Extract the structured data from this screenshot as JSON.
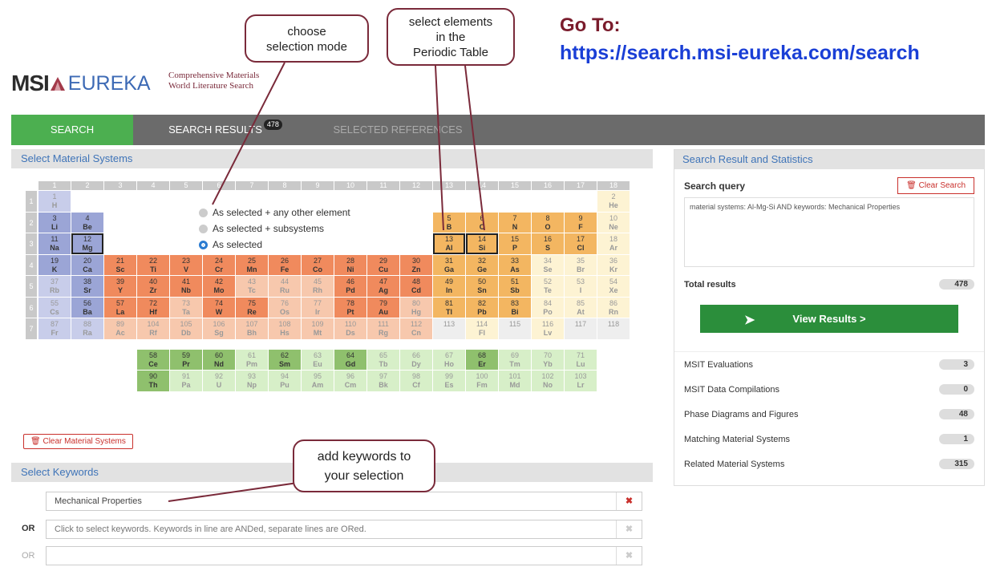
{
  "goto": {
    "title": "Go To:",
    "url": "https://search.msi-eureka.com/search"
  },
  "callouts": {
    "mode": "choose\nselection mode",
    "select": "select elements\nin the\nPeriodic Table",
    "keywords": "add keywords to\nyour selection"
  },
  "logo": {
    "msi": "MSI",
    "eureka": "EUREKA",
    "tagline1": "Comprehensive Materials",
    "tagline2": "World Literature Search"
  },
  "tabs": {
    "search": "SEARCH",
    "results": "SEARCH RESULTS",
    "results_count": "478",
    "selected": "SELECTED REFERENCES"
  },
  "left": {
    "title": "Select Material Systems",
    "clear": "Clear Material Systems"
  },
  "radios": [
    "As selected + any other element",
    "As selected + subsystems",
    "As selected"
  ],
  "keywords": {
    "title": "Select Keywords",
    "row1": "Mechanical Properties",
    "or1": "OR",
    "row2_placeholder": "Click to select keywords. Keywords in line are ANDed, separate lines are ORed.",
    "or2": "OR"
  },
  "right": {
    "title": "Search Result and Statistics",
    "query_label": "Search query",
    "clear": "Clear Search",
    "query": "material systems: Al-Mg-Si AND keywords: Mechanical Properties",
    "total_label": "Total results",
    "total": "478",
    "view": "View Results >"
  },
  "stats": [
    {
      "label": "MSIT Evaluations",
      "value": "3"
    },
    {
      "label": "MSIT Data Compilations",
      "value": "0"
    },
    {
      "label": "Phase Diagrams and Figures",
      "value": "48"
    },
    {
      "label": "Matching Material Systems",
      "value": "1"
    },
    {
      "label": "Related Material Systems",
      "value": "315"
    }
  ],
  "periodic": {
    "groups": [
      "1",
      "2",
      "3",
      "4",
      "5",
      "6",
      "7",
      "8",
      "9",
      "10",
      "11",
      "12",
      "13",
      "14",
      "15",
      "16",
      "17",
      "18"
    ],
    "periods": [
      "1",
      "2",
      "3",
      "4",
      "5",
      "6",
      "7"
    ],
    "elements": [
      [
        "1",
        "H",
        1,
        1,
        "b",
        0
      ],
      [
        "2",
        "He",
        18,
        1,
        "y",
        0
      ],
      [
        "3",
        "Li",
        1,
        2,
        "b",
        1
      ],
      [
        "4",
        "Be",
        2,
        2,
        "b",
        1
      ],
      [
        "5",
        "B",
        13,
        2,
        "o",
        1
      ],
      [
        "6",
        "C",
        14,
        2,
        "o",
        1
      ],
      [
        "7",
        "N",
        15,
        2,
        "o",
        1
      ],
      [
        "8",
        "O",
        16,
        2,
        "o",
        1
      ],
      [
        "9",
        "F",
        17,
        2,
        "o",
        1
      ],
      [
        "10",
        "Ne",
        18,
        2,
        "y",
        0
      ],
      [
        "11",
        "Na",
        1,
        3,
        "b",
        1
      ],
      [
        "12",
        "Mg",
        2,
        3,
        "b",
        1
      ],
      [
        "13",
        "Al",
        13,
        3,
        "o",
        1
      ],
      [
        "14",
        "Si",
        14,
        3,
        "o",
        1
      ],
      [
        "15",
        "P",
        15,
        3,
        "o",
        1
      ],
      [
        "16",
        "S",
        16,
        3,
        "o",
        1
      ],
      [
        "17",
        "Cl",
        17,
        3,
        "o",
        1
      ],
      [
        "18",
        "Ar",
        18,
        3,
        "y",
        0
      ],
      [
        "19",
        "K",
        1,
        4,
        "b",
        1
      ],
      [
        "20",
        "Ca",
        2,
        4,
        "b",
        1
      ],
      [
        "21",
        "Sc",
        3,
        4,
        "r",
        1
      ],
      [
        "22",
        "Ti",
        4,
        4,
        "r",
        1
      ],
      [
        "23",
        "V",
        5,
        4,
        "r",
        1
      ],
      [
        "24",
        "Cr",
        6,
        4,
        "r",
        1
      ],
      [
        "25",
        "Mn",
        7,
        4,
        "r",
        1
      ],
      [
        "26",
        "Fe",
        8,
        4,
        "r",
        1
      ],
      [
        "27",
        "Co",
        9,
        4,
        "r",
        1
      ],
      [
        "28",
        "Ni",
        10,
        4,
        "r",
        1
      ],
      [
        "29",
        "Cu",
        11,
        4,
        "r",
        1
      ],
      [
        "30",
        "Zn",
        12,
        4,
        "r",
        1
      ],
      [
        "31",
        "Ga",
        13,
        4,
        "o",
        1
      ],
      [
        "32",
        "Ge",
        14,
        4,
        "o",
        1
      ],
      [
        "33",
        "As",
        15,
        4,
        "o",
        1
      ],
      [
        "34",
        "Se",
        16,
        4,
        "y",
        0
      ],
      [
        "35",
        "Br",
        17,
        4,
        "y",
        0
      ],
      [
        "36",
        "Kr",
        18,
        4,
        "y",
        0
      ],
      [
        "37",
        "Rb",
        1,
        5,
        "b",
        0
      ],
      [
        "38",
        "Sr",
        2,
        5,
        "b",
        1
      ],
      [
        "39",
        "Y",
        3,
        5,
        "r",
        1
      ],
      [
        "40",
        "Zr",
        4,
        5,
        "r",
        1
      ],
      [
        "41",
        "Nb",
        5,
        5,
        "r",
        1
      ],
      [
        "42",
        "Mo",
        6,
        5,
        "r",
        1
      ],
      [
        "43",
        "Tc",
        7,
        5,
        "r",
        0
      ],
      [
        "44",
        "Ru",
        8,
        5,
        "r",
        0
      ],
      [
        "45",
        "Rh",
        9,
        5,
        "r",
        0
      ],
      [
        "46",
        "Pd",
        10,
        5,
        "r",
        1
      ],
      [
        "47",
        "Ag",
        11,
        5,
        "r",
        1
      ],
      [
        "48",
        "Cd",
        12,
        5,
        "r",
        1
      ],
      [
        "49",
        "In",
        13,
        5,
        "o",
        1
      ],
      [
        "50",
        "Sn",
        14,
        5,
        "o",
        1
      ],
      [
        "51",
        "Sb",
        15,
        5,
        "o",
        1
      ],
      [
        "52",
        "Te",
        16,
        5,
        "y",
        0
      ],
      [
        "53",
        "I",
        17,
        5,
        "y",
        0
      ],
      [
        "54",
        "Xe",
        18,
        5,
        "y",
        0
      ],
      [
        "55",
        "Cs",
        1,
        6,
        "b",
        0
      ],
      [
        "56",
        "Ba",
        2,
        6,
        "b",
        1
      ],
      [
        "57",
        "La",
        3,
        6,
        "r",
        1
      ],
      [
        "72",
        "Hf",
        4,
        6,
        "r",
        1
      ],
      [
        "73",
        "Ta",
        5,
        6,
        "r",
        0
      ],
      [
        "74",
        "W",
        6,
        6,
        "r",
        1
      ],
      [
        "75",
        "Re",
        7,
        6,
        "r",
        1
      ],
      [
        "76",
        "Os",
        8,
        6,
        "r",
        0
      ],
      [
        "77",
        "Ir",
        9,
        6,
        "r",
        0
      ],
      [
        "78",
        "Pt",
        10,
        6,
        "r",
        1
      ],
      [
        "79",
        "Au",
        11,
        6,
        "r",
        1
      ],
      [
        "80",
        "Hg",
        12,
        6,
        "r",
        0
      ],
      [
        "81",
        "Tl",
        13,
        6,
        "o",
        1
      ],
      [
        "82",
        "Pb",
        14,
        6,
        "o",
        1
      ],
      [
        "83",
        "Bi",
        15,
        6,
        "o",
        1
      ],
      [
        "84",
        "Po",
        16,
        6,
        "y",
        0
      ],
      [
        "85",
        "At",
        17,
        6,
        "y",
        0
      ],
      [
        "86",
        "Rn",
        18,
        6,
        "y",
        0
      ],
      [
        "87",
        "Fr",
        1,
        7,
        "b",
        0
      ],
      [
        "88",
        "Ra",
        2,
        7,
        "b",
        0
      ],
      [
        "89",
        "Ac",
        3,
        7,
        "r",
        0
      ],
      [
        "104",
        "Rf",
        4,
        7,
        "r",
        0
      ],
      [
        "105",
        "Db",
        5,
        7,
        "r",
        0
      ],
      [
        "106",
        "Sg",
        6,
        7,
        "r",
        0
      ],
      [
        "107",
        "Bh",
        7,
        7,
        "r",
        0
      ],
      [
        "108",
        "Hs",
        8,
        7,
        "r",
        0
      ],
      [
        "109",
        "Mt",
        9,
        7,
        "r",
        0
      ],
      [
        "110",
        "Ds",
        10,
        7,
        "r",
        0
      ],
      [
        "111",
        "Rg",
        11,
        7,
        "r",
        0
      ],
      [
        "112",
        "Cn",
        12,
        7,
        "r",
        0
      ],
      [
        "113",
        "",
        13,
        7,
        "w",
        0
      ],
      [
        "114",
        "Fl",
        14,
        7,
        "y",
        0
      ],
      [
        "115",
        "",
        15,
        7,
        "w",
        0
      ],
      [
        "116",
        "Lv",
        16,
        7,
        "y",
        0
      ],
      [
        "117",
        "",
        17,
        7,
        "w",
        0
      ],
      [
        "118",
        "",
        18,
        7,
        "w",
        0
      ],
      [
        "58",
        "Ce",
        4,
        9,
        "g",
        1
      ],
      [
        "59",
        "Pr",
        5,
        9,
        "g",
        1
      ],
      [
        "60",
        "Nd",
        6,
        9,
        "g",
        1
      ],
      [
        "61",
        "Pm",
        7,
        9,
        "g",
        0
      ],
      [
        "62",
        "Sm",
        8,
        9,
        "g",
        1
      ],
      [
        "63",
        "Eu",
        9,
        9,
        "g",
        0
      ],
      [
        "64",
        "Gd",
        10,
        9,
        "g",
        1
      ],
      [
        "65",
        "Tb",
        11,
        9,
        "g",
        0
      ],
      [
        "66",
        "Dy",
        12,
        9,
        "g",
        0
      ],
      [
        "67",
        "Ho",
        13,
        9,
        "g",
        0
      ],
      [
        "68",
        "Er",
        14,
        9,
        "g",
        1
      ],
      [
        "69",
        "Tm",
        15,
        9,
        "g",
        0
      ],
      [
        "70",
        "Yb",
        16,
        9,
        "g",
        0
      ],
      [
        "71",
        "Lu",
        17,
        9,
        "g",
        0
      ],
      [
        "90",
        "Th",
        4,
        10,
        "g",
        1
      ],
      [
        "91",
        "Pa",
        5,
        10,
        "g",
        0
      ],
      [
        "92",
        "U",
        6,
        10,
        "g",
        0
      ],
      [
        "93",
        "Np",
        7,
        10,
        "g",
        0
      ],
      [
        "94",
        "Pu",
        8,
        10,
        "g",
        0
      ],
      [
        "95",
        "Am",
        9,
        10,
        "g",
        0
      ],
      [
        "96",
        "Cm",
        10,
        10,
        "g",
        0
      ],
      [
        "97",
        "Bk",
        11,
        10,
        "g",
        0
      ],
      [
        "98",
        "Cf",
        12,
        10,
        "g",
        0
      ],
      [
        "99",
        "Es",
        13,
        10,
        "g",
        0
      ],
      [
        "100",
        "Fm",
        14,
        10,
        "g",
        0
      ],
      [
        "101",
        "Md",
        15,
        10,
        "g",
        0
      ],
      [
        "102",
        "No",
        16,
        10,
        "g",
        0
      ],
      [
        "103",
        "Lr",
        17,
        10,
        "g",
        0
      ]
    ],
    "selected": [
      "Mg",
      "Al",
      "Si"
    ]
  },
  "colors": {
    "b": [
      "#9ba5d6",
      "#c8cdea"
    ],
    "r": [
      "#f08a5d",
      "#f7c8ad"
    ],
    "o": [
      "#f3b661",
      "#f9dcae"
    ],
    "y": [
      "#fbe6a2",
      "#fdf3d3"
    ],
    "g": [
      "#8fc06d",
      "#d7efc8"
    ],
    "w": [
      "#eeeeee",
      "#eeeeee"
    ],
    "accent": "#4caf50",
    "brand": "#7a2a3a"
  }
}
